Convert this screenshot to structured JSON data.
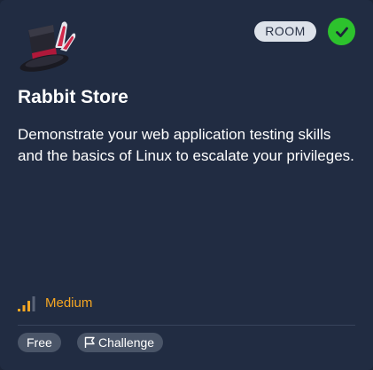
{
  "room": {
    "title": "Rabbit Store",
    "type_badge": "ROOM",
    "completed": true,
    "description": "Demonstrate your web application testing skills and the basics of Linux to escalate your privileges.",
    "difficulty": "Medium",
    "tags": [
      "Free",
      "Challenge"
    ]
  },
  "colors": {
    "card_background": "#212c42",
    "difficulty": "#f5a623",
    "completed_check": "#2dc22d",
    "badge_background": "#dde2ea",
    "tag_background": "#4a5568"
  },
  "icons": {
    "logo": "top-hat-rabbit-ears-logo",
    "completed": "check-icon",
    "difficulty": "signal-bars-icon",
    "challenge_tag": "flag-icon"
  }
}
